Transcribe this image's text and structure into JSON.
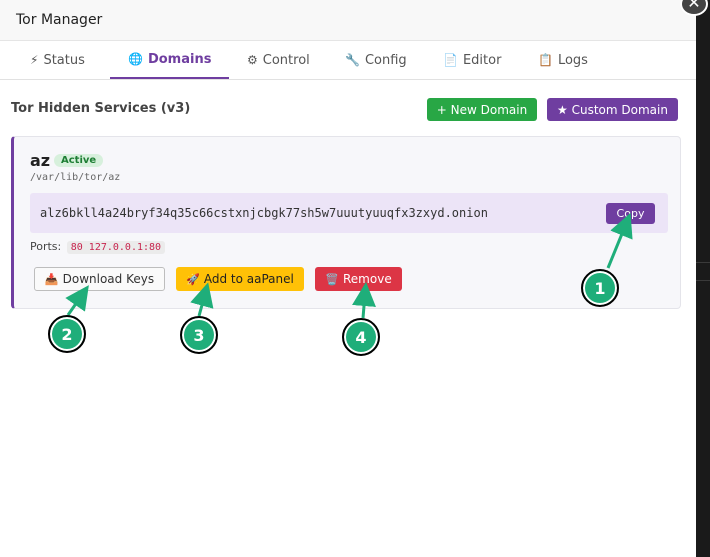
{
  "window": {
    "title": "Tor Manager",
    "close_glyph": "✕"
  },
  "tabs": [
    {
      "icon": "⚡",
      "label": "Status"
    },
    {
      "icon": "🌐",
      "label": "Domains"
    },
    {
      "icon": "⚙",
      "label": "Control"
    },
    {
      "icon": "🔧",
      "label": "Config"
    },
    {
      "icon": "📄",
      "label": "Editor"
    },
    {
      "icon": "📋",
      "label": "Logs"
    }
  ],
  "active_tab": "Domains",
  "section": {
    "title": "Tor Hidden Services (v3)",
    "new_domain_label": "+ New Domain",
    "custom_domain_label": "★ Custom Domain"
  },
  "service": {
    "name": "az",
    "status": "Active",
    "path": "/var/lib/tor/az",
    "onion": "alz6bkll4a24bryf34q35c66cstxnjcbgk77sh5w7uuutyuuqfx3zxyd.onion",
    "copy_label": "Copy",
    "ports_label": "Ports:",
    "ports_value": "80 127.0.0.1:80",
    "download_icon": "📥",
    "download_label": "Download Keys",
    "aapanel_icon": "🚀",
    "aapanel_label": "Add to aaPanel",
    "remove_icon": "🗑️",
    "remove_label": "Remove"
  },
  "annotations": [
    "1",
    "2",
    "3",
    "4"
  ],
  "colors": {
    "accent": "#6f3ea0",
    "success": "#28a745",
    "warning": "#ffc107",
    "danger": "#dc3545",
    "annotation": "#1fae7a"
  }
}
